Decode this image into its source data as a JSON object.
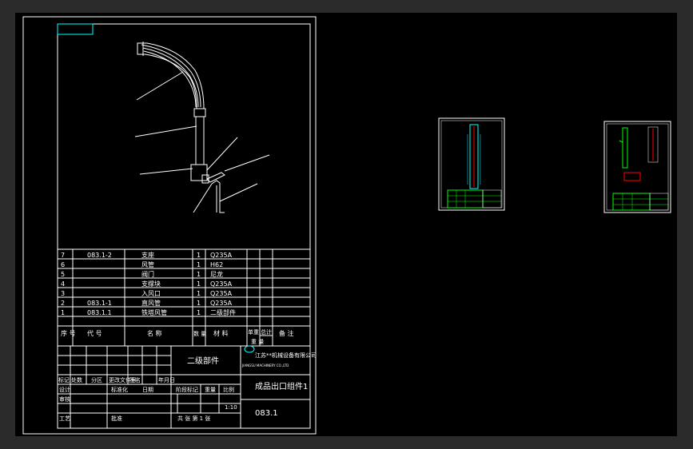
{
  "bom_rows": [
    {
      "no": "7",
      "code": "083.1-2",
      "name": "支座",
      "qty": "1",
      "material": "Q235A",
      "note": ""
    },
    {
      "no": "6",
      "code": "",
      "name": "风管",
      "qty": "1",
      "material": "H62",
      "note": ""
    },
    {
      "no": "5",
      "code": "",
      "name": "阀门",
      "qty": "1",
      "material": "尼龙",
      "note": ""
    },
    {
      "no": "4",
      "code": "",
      "name": "支撑块",
      "qty": "1",
      "material": "Q235A",
      "note": ""
    },
    {
      "no": "3",
      "code": "",
      "name": "入风口",
      "qty": "1",
      "material": "Q235A",
      "note": ""
    },
    {
      "no": "2",
      "code": "083.1-1",
      "name": "直风管",
      "qty": "1",
      "material": "Q235A",
      "note": ""
    },
    {
      "no": "1",
      "code": "083.1.1",
      "name": "铁塔风管",
      "qty": "1",
      "material": "二级部件",
      "note": ""
    }
  ],
  "bom_header": {
    "no": "序 号",
    "code": "代   号",
    "name": "名   称",
    "qty": "数 量",
    "material": "材   料",
    "single": "单重",
    "total": "总计",
    "weight": "重  量",
    "note": "备  注"
  },
  "title_block": {
    "level": "二级部件",
    "company": "江苏**机械设备有限公司",
    "company_en": "JIANGSU MACHINERY CO.,LTD",
    "drawing_name": "成品出口组件1",
    "drawing_no": "083.1",
    "scale": "1:10",
    "sheet": "共   张      第 1 张",
    "stage_label": "阶段标记",
    "weight_label": "重量",
    "scale_label": "比例",
    "rev_labels": [
      "标记",
      "处数",
      "分区",
      "更改文件号",
      "签名",
      "年月日"
    ],
    "role_labels": [
      "设计",
      "审核",
      "工艺"
    ],
    "std_label": "标准化",
    "approve_label": "批准",
    "date_label": "日期"
  },
  "colors": {
    "background": "#2b2b2b",
    "canvas": "#000000",
    "lines": "#ffffff",
    "accent": "#00ffff",
    "green": "#00ff00",
    "red": "#ff0000"
  }
}
